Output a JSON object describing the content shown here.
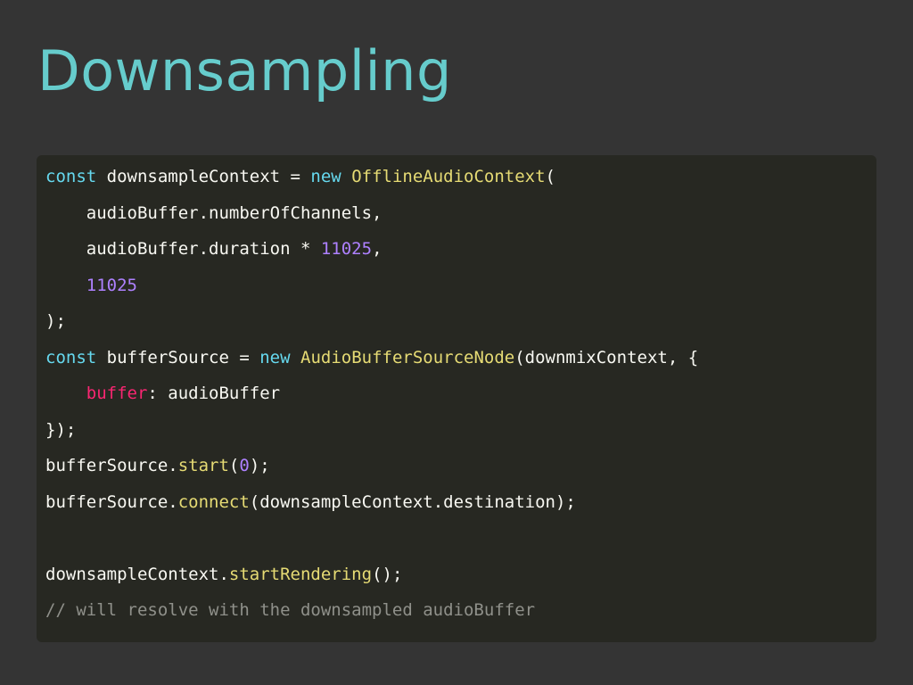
{
  "slide": {
    "title": "Downsampling"
  },
  "colors": {
    "background": "#343434",
    "title": "#66cccc",
    "code_background": "#272822",
    "keyword": "#66d9ef",
    "function": "#e6db74",
    "number": "#ae81ff",
    "property": "#f92672",
    "comment": "#8f908a",
    "text": "#f8f8f2"
  },
  "code": {
    "lines": [
      [
        {
          "t": "const",
          "k": "kw"
        },
        {
          "t": " downsampleContext = ",
          "k": "plain"
        },
        {
          "t": "new",
          "k": "kw"
        },
        {
          "t": " ",
          "k": "plain"
        },
        {
          "t": "OfflineAudioContext",
          "k": "fn"
        },
        {
          "t": "(",
          "k": "plain"
        }
      ],
      [
        {
          "t": "    audioBuffer.numberOfChannels,",
          "k": "plain"
        }
      ],
      [
        {
          "t": "    audioBuffer.duration * ",
          "k": "plain"
        },
        {
          "t": "11025",
          "k": "num"
        },
        {
          "t": ",",
          "k": "plain"
        }
      ],
      [
        {
          "t": "    ",
          "k": "plain"
        },
        {
          "t": "11025",
          "k": "num"
        }
      ],
      [
        {
          "t": ");",
          "k": "plain"
        }
      ],
      [
        {
          "t": "const",
          "k": "kw"
        },
        {
          "t": " bufferSource = ",
          "k": "plain"
        },
        {
          "t": "new",
          "k": "kw"
        },
        {
          "t": " ",
          "k": "plain"
        },
        {
          "t": "AudioBufferSourceNode",
          "k": "fn"
        },
        {
          "t": "(downmixContext, {",
          "k": "plain"
        }
      ],
      [
        {
          "t": "    ",
          "k": "plain"
        },
        {
          "t": "buffer",
          "k": "prop"
        },
        {
          "t": ": audioBuffer",
          "k": "plain"
        }
      ],
      [
        {
          "t": "});",
          "k": "plain"
        }
      ],
      [
        {
          "t": "bufferSource.",
          "k": "plain"
        },
        {
          "t": "start",
          "k": "fn"
        },
        {
          "t": "(",
          "k": "plain"
        },
        {
          "t": "0",
          "k": "num"
        },
        {
          "t": ");",
          "k": "plain"
        }
      ],
      [
        {
          "t": "bufferSource.",
          "k": "plain"
        },
        {
          "t": "connect",
          "k": "fn"
        },
        {
          "t": "(downsampleContext.destination);",
          "k": "plain"
        }
      ],
      [],
      [
        {
          "t": "downsampleContext.",
          "k": "plain"
        },
        {
          "t": "startRendering",
          "k": "fn"
        },
        {
          "t": "();",
          "k": "plain"
        }
      ],
      [
        {
          "t": "// will resolve with the downsampled audioBuffer",
          "k": "cmt"
        }
      ]
    ]
  }
}
